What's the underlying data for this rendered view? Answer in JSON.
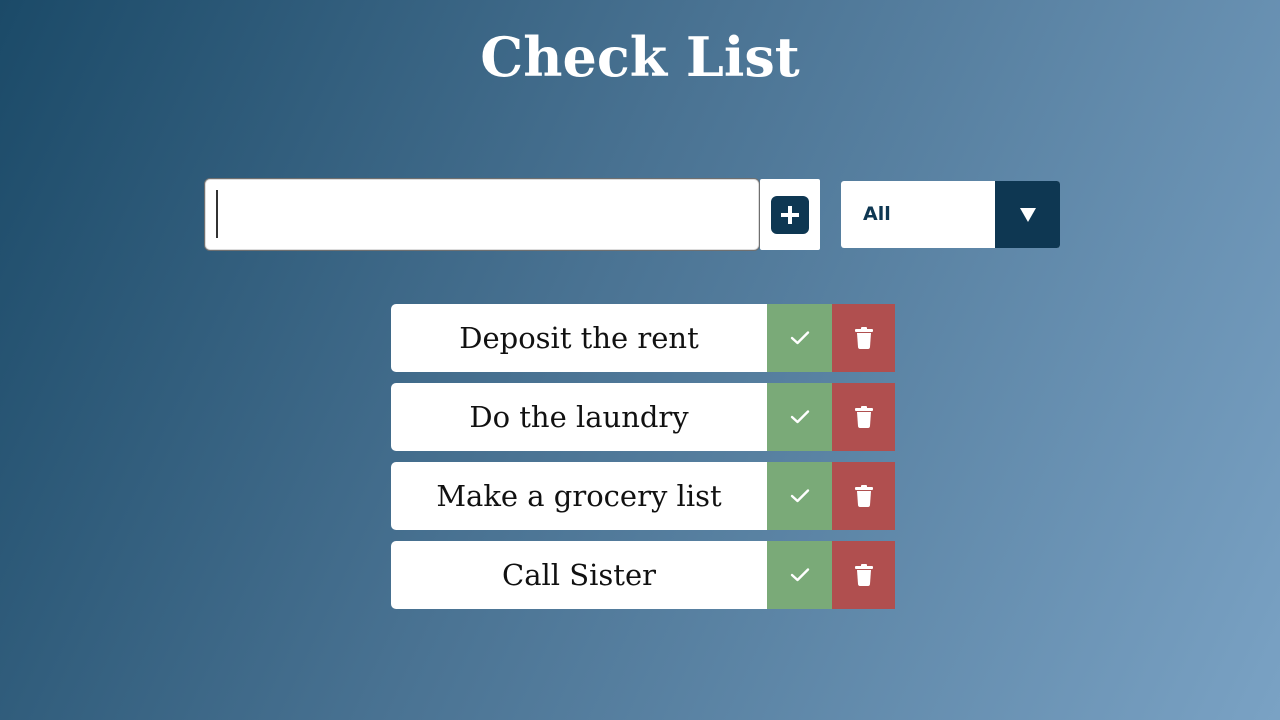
{
  "header": {
    "title": "Check List"
  },
  "form": {
    "input_value": "",
    "add_icon": "plus-square-icon"
  },
  "filter": {
    "selected": "All",
    "arrow_icon": "caret-down-icon"
  },
  "todos": [
    {
      "text": "Deposit the rent"
    },
    {
      "text": "Do the laundry"
    },
    {
      "text": "Make a grocery list"
    },
    {
      "text": "Call Sister"
    }
  ],
  "icons": {
    "complete": "check-icon",
    "delete": "trash-icon"
  },
  "colors": {
    "accent_dark": "#0e3752",
    "complete_green": "#7aaa78",
    "delete_red": "#b04f4f"
  }
}
